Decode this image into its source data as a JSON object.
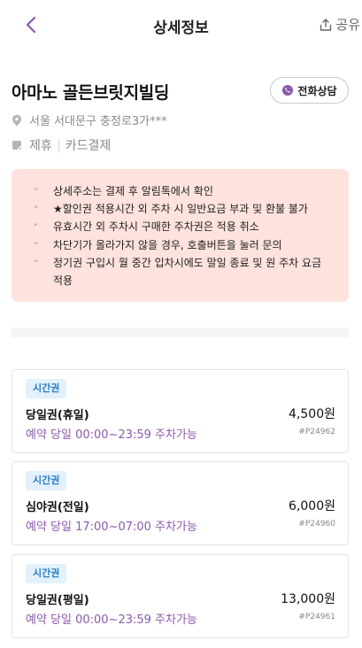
{
  "header": {
    "title": "상세정보",
    "share_label": "공유"
  },
  "lot": {
    "name": "아마노 골든브릿지빌딩",
    "call_label": "전화상담",
    "address": "서울 서대문구 충정로3가***",
    "tags": [
      "제휴",
      "카드결제"
    ]
  },
  "notices": [
    {
      "lines": [
        "상세주소는 결제 후 알림톡에서 확인"
      ]
    },
    {
      "lines": [
        "★할인권 적용시간 외 주차 시 일반요금 부과 및 환불 불가"
      ]
    },
    {
      "lines": [
        "유효시간 외 주차시 구매한 주차권은 적용 취소"
      ]
    },
    {
      "lines": [
        "차단기가 올라가지 않을 경우, 호출버튼을 눌러 문의"
      ]
    },
    {
      "lines": [
        "정기권 구입시 월 중간 입차시에도 말일 종료 및 원 주차 요금",
        "적용"
      ]
    }
  ],
  "tickets": [
    {
      "badge": "시간권",
      "name": "당일권(휴일)",
      "price": "4,500원",
      "time": "예약 당일 00:00~23:59 주차가능",
      "code": "#P24962"
    },
    {
      "badge": "시간권",
      "name": "심야권(전일)",
      "price": "6,000원",
      "time": "예약 당일 17:00~07:00 주차가능",
      "code": "#P24960"
    },
    {
      "badge": "시간권",
      "name": "당일권(평일)",
      "price": "13,000원",
      "time": "예약 당일 00:00~23:59 주차가능",
      "code": "#P24961"
    }
  ],
  "colors": {
    "accent_purple": "#8a5aab",
    "notice_bg": "#fde2dd",
    "notice_check": "#d9534f",
    "badge_bg": "#e2f1fb",
    "badge_text": "#2b7fc0"
  }
}
